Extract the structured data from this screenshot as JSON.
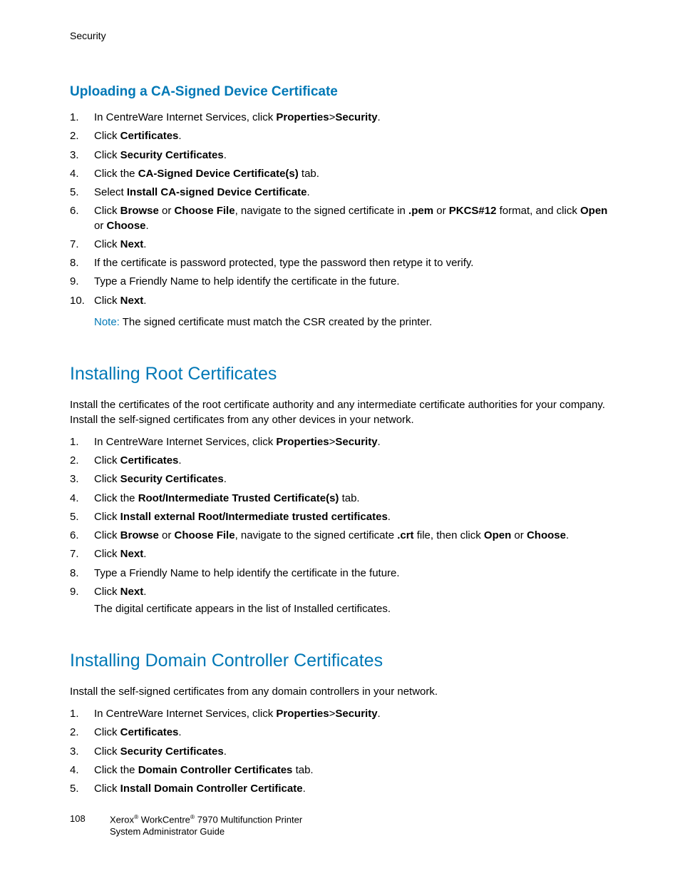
{
  "header": "Security",
  "section1": {
    "title": "Uploading a CA-Signed Device Certificate",
    "steps": [
      {
        "n": "1.",
        "html": "In CentreWare Internet Services, click <b>Properties</b>><b>Security</b>."
      },
      {
        "n": "2.",
        "html": "Click <b>Certificates</b>."
      },
      {
        "n": "3.",
        "html": "Click <b>Security Certificates</b>."
      },
      {
        "n": "4.",
        "html": "Click the <b>CA-Signed Device Certificate(s)</b> tab."
      },
      {
        "n": "5.",
        "html": "Select <b>Install CA-signed Device Certificate</b>."
      },
      {
        "n": "6.",
        "html": "Click <b>Browse</b> or <b>Choose File</b>, navigate to the signed certificate in <b>.pem</b> or <b>PKCS#12</b> format, and click <b>Open</b> or <b>Choose</b>."
      },
      {
        "n": "7.",
        "html": "Click <b>Next</b>."
      },
      {
        "n": "8.",
        "html": "If the certificate is password protected, type the password then retype it to verify."
      },
      {
        "n": "9.",
        "html": "Type a Friendly Name to help identify the certificate in the future."
      },
      {
        "n": "10.",
        "html": "Click <b>Next</b>."
      }
    ],
    "noteLabel": "Note:",
    "noteText": " The signed certificate must match the CSR created by the printer."
  },
  "section2": {
    "title": "Installing Root Certificates",
    "intro": "Install the certificates of the root certificate authority and any intermediate certificate authorities for your company. Install the self-signed certificates from any other devices in your network.",
    "steps": [
      {
        "n": "1.",
        "html": "In CentreWare Internet Services, click <b>Properties</b>><b>Security</b>."
      },
      {
        "n": "2.",
        "html": "Click <b>Certificates</b>."
      },
      {
        "n": "3.",
        "html": "Click <b>Security Certificates</b>."
      },
      {
        "n": "4.",
        "html": "Click the <b>Root/Intermediate Trusted Certificate(s)</b> tab."
      },
      {
        "n": "5.",
        "html": "Click <b>Install external Root/Intermediate trusted certificates</b>."
      },
      {
        "n": "6.",
        "html": "Click <b>Browse</b> or <b>Choose File</b>, navigate to the signed certificate <b>.crt</b> file, then click <b>Open</b> or <b>Choose</b>."
      },
      {
        "n": "7.",
        "html": "Click <b>Next</b>."
      },
      {
        "n": "8.",
        "html": "Type a Friendly Name to help identify the certificate in the future."
      },
      {
        "n": "9.",
        "html": "Click <b>Next</b>."
      }
    ],
    "after": "The digital certificate appears in the list of Installed certificates."
  },
  "section3": {
    "title": "Installing Domain Controller Certificates",
    "intro": "Install the self-signed certificates from any domain controllers in your network.",
    "steps": [
      {
        "n": "1.",
        "html": "In CentreWare Internet Services, click <b>Properties</b>><b>Security</b>."
      },
      {
        "n": "2.",
        "html": "Click <b>Certificates</b>."
      },
      {
        "n": "3.",
        "html": "Click <b>Security Certificates</b>."
      },
      {
        "n": "4.",
        "html": "Click the <b>Domain Controller Certificates</b> tab."
      },
      {
        "n": "5.",
        "html": "Click <b>Install Domain Controller Certificate</b>."
      }
    ]
  },
  "footer": {
    "pageNumber": "108",
    "line1_html": "Xerox<sup>®</sup> WorkCentre<sup>®</sup> 7970 Multifunction Printer",
    "line2": "System Administrator Guide"
  }
}
